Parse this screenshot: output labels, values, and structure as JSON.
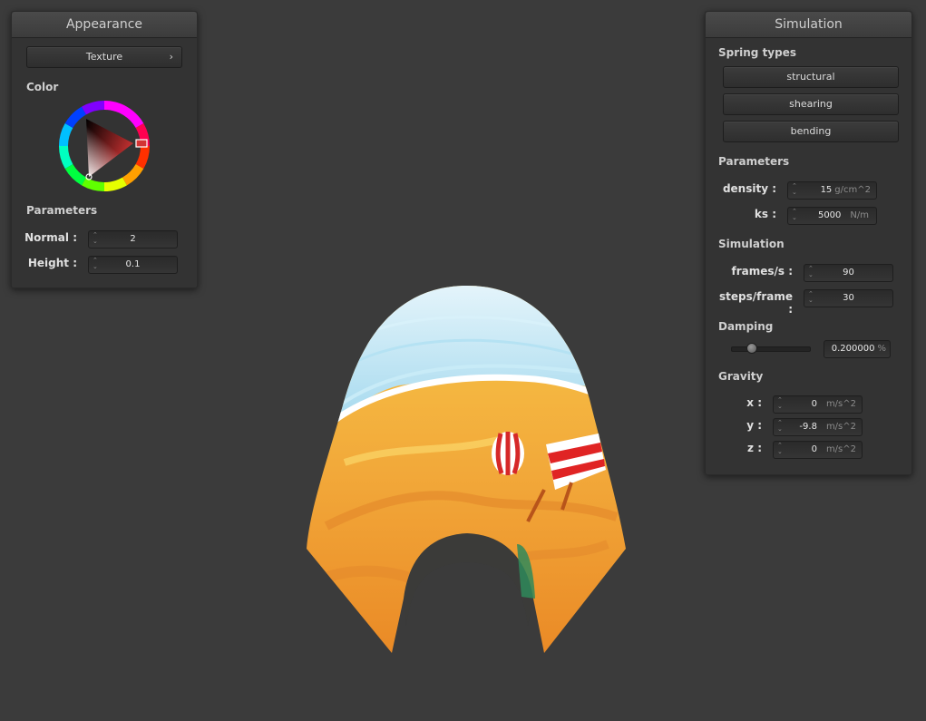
{
  "appearance": {
    "title": "Appearance",
    "texture_button": "Texture",
    "texture_chevron": "›",
    "color_label": "Color",
    "parameters_label": "Parameters",
    "normal_label": "Normal :",
    "normal_value": "2",
    "height_label": "Height :",
    "height_value": "0.1",
    "color_value": "#d33434"
  },
  "simulation": {
    "title": "Simulation",
    "spring_types_label": "Spring types",
    "spring_buttons": [
      "structural",
      "shearing",
      "bending"
    ],
    "parameters_label": "Parameters",
    "density_label": "density :",
    "density_value": "15",
    "density_unit": "g/cm^2",
    "ks_label": "ks :",
    "ks_value": "5000",
    "ks_unit": "N/m",
    "simulation_label": "Simulation",
    "fps_label": "frames/s :",
    "fps_value": "90",
    "steps_label": "steps/frame :",
    "steps_value": "30",
    "damping_label": "Damping",
    "damping_value": "0.200000",
    "damping_unit": "%",
    "damping_fraction": 0.2,
    "gravity_label": "Gravity",
    "gx_label": "x :",
    "gx_value": "0",
    "gy_label": "y :",
    "gy_value": "-9.8",
    "gz_label": "z :",
    "gz_value": "0",
    "gravity_unit": "m/s^2"
  }
}
